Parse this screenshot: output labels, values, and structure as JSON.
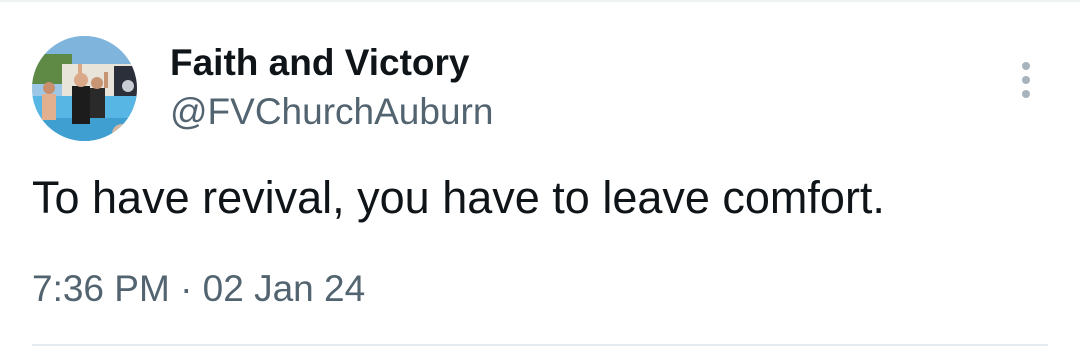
{
  "tweet": {
    "author": {
      "display_name": "Faith and Victory",
      "handle": "@FVChurchAuburn",
      "avatar_icon": "profile-photo"
    },
    "text": "To have revival, you have to leave comfort.",
    "timestamp": "7:36 PM · 02 Jan 24",
    "more_icon": "more-vertical-icon"
  },
  "colors": {
    "text_primary": "#0f1419",
    "text_secondary": "#536471",
    "icon_muted": "#a8b4bd",
    "divider": "#eff3f4"
  }
}
